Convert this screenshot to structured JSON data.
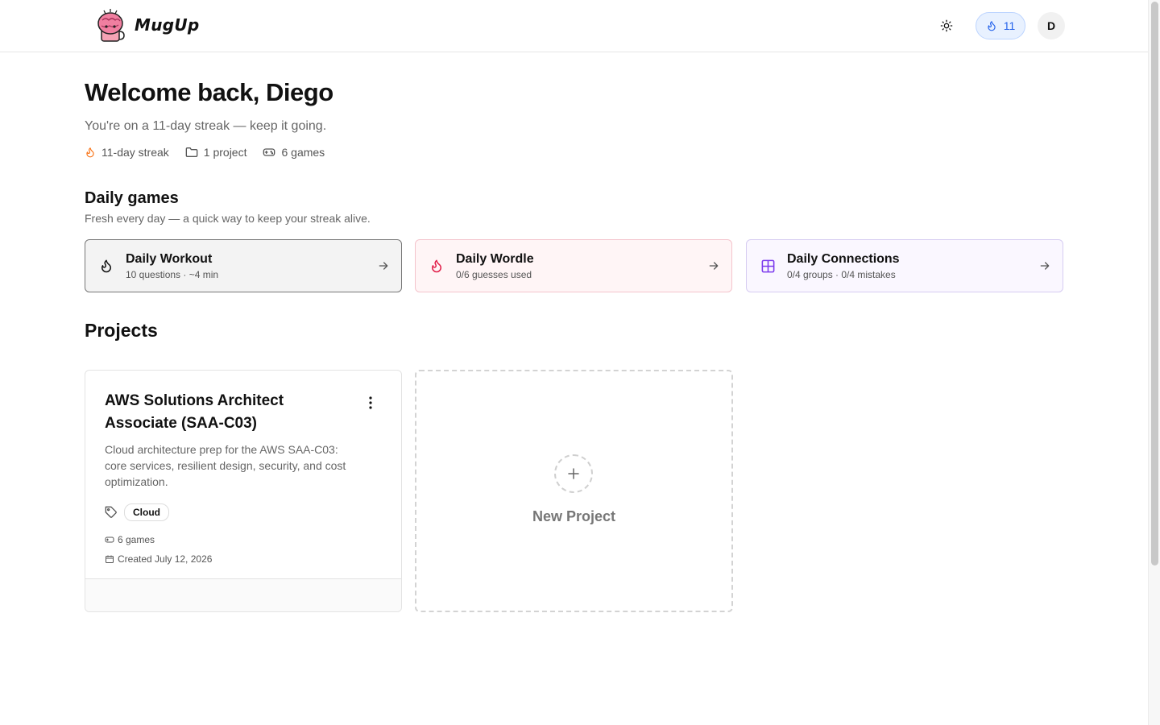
{
  "header": {
    "brand": "MugUp",
    "streak_count": "11",
    "avatar_initial": "D"
  },
  "hero": {
    "welcome": "Welcome back, Diego",
    "streak_message": "You're on a 11-day streak — keep it going.",
    "stats": {
      "streak": "11-day streak",
      "projects": "1 project",
      "games": "6 games"
    }
  },
  "daily_games": {
    "title": "Daily games",
    "subtitle": "Fresh every day — a quick way to keep your streak alive.",
    "items": [
      {
        "title": "Daily Workout",
        "subtitle": "10 questions · ~4 min",
        "icon": "flame-outline-icon"
      },
      {
        "title": "Daily Wordle",
        "subtitle": "0/6 guesses used",
        "icon": "flame-icon"
      },
      {
        "title": "Daily Connections",
        "subtitle": "0/4 groups · 0/4 mistakes",
        "icon": "grid-icon"
      }
    ]
  },
  "projects": {
    "title": "Projects",
    "items": [
      {
        "title": "AWS Solutions Architect Associate (SAA-C03)",
        "description": "Cloud architecture prep for the AWS SAA-C03: core services, resilient design, security, and cost optimization.",
        "tag": "Cloud",
        "games": "6 games",
        "created": "Created July 12, 2026"
      }
    ],
    "new_label": "New Project"
  },
  "colors": {
    "accent_blue": "#2563eb",
    "flame_orange": "#f97316",
    "wordle_red": "#e11d48",
    "connections_purple": "#7c3aed"
  }
}
